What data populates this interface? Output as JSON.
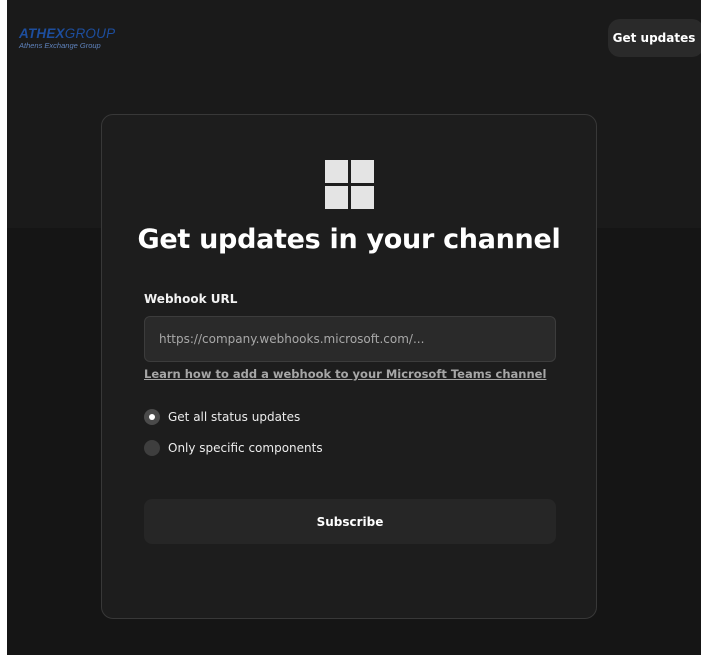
{
  "brand": {
    "logo_bold": "ATHEX",
    "logo_light": "GROUP",
    "logo_sub": "Athens Exchange Group"
  },
  "header": {
    "get_updates_label": "Get updates"
  },
  "card": {
    "icon": "microsoft-teams-icon",
    "title": "Get updates in your channel",
    "webhook_label": "Webhook URL",
    "webhook_value": "",
    "webhook_placeholder": "https://company.webhooks.microsoft.com/...",
    "help_link": "Learn how to add a webhook to your Microsoft Teams channel",
    "options": [
      {
        "label": "Get all status updates",
        "selected": true
      },
      {
        "label": "Only specific components",
        "selected": false
      }
    ],
    "subscribe_label": "Subscribe"
  },
  "colors": {
    "background": "#151515",
    "card": "#1d1d1d",
    "brand": "#1d4e9e",
    "text": "#ffffff"
  }
}
